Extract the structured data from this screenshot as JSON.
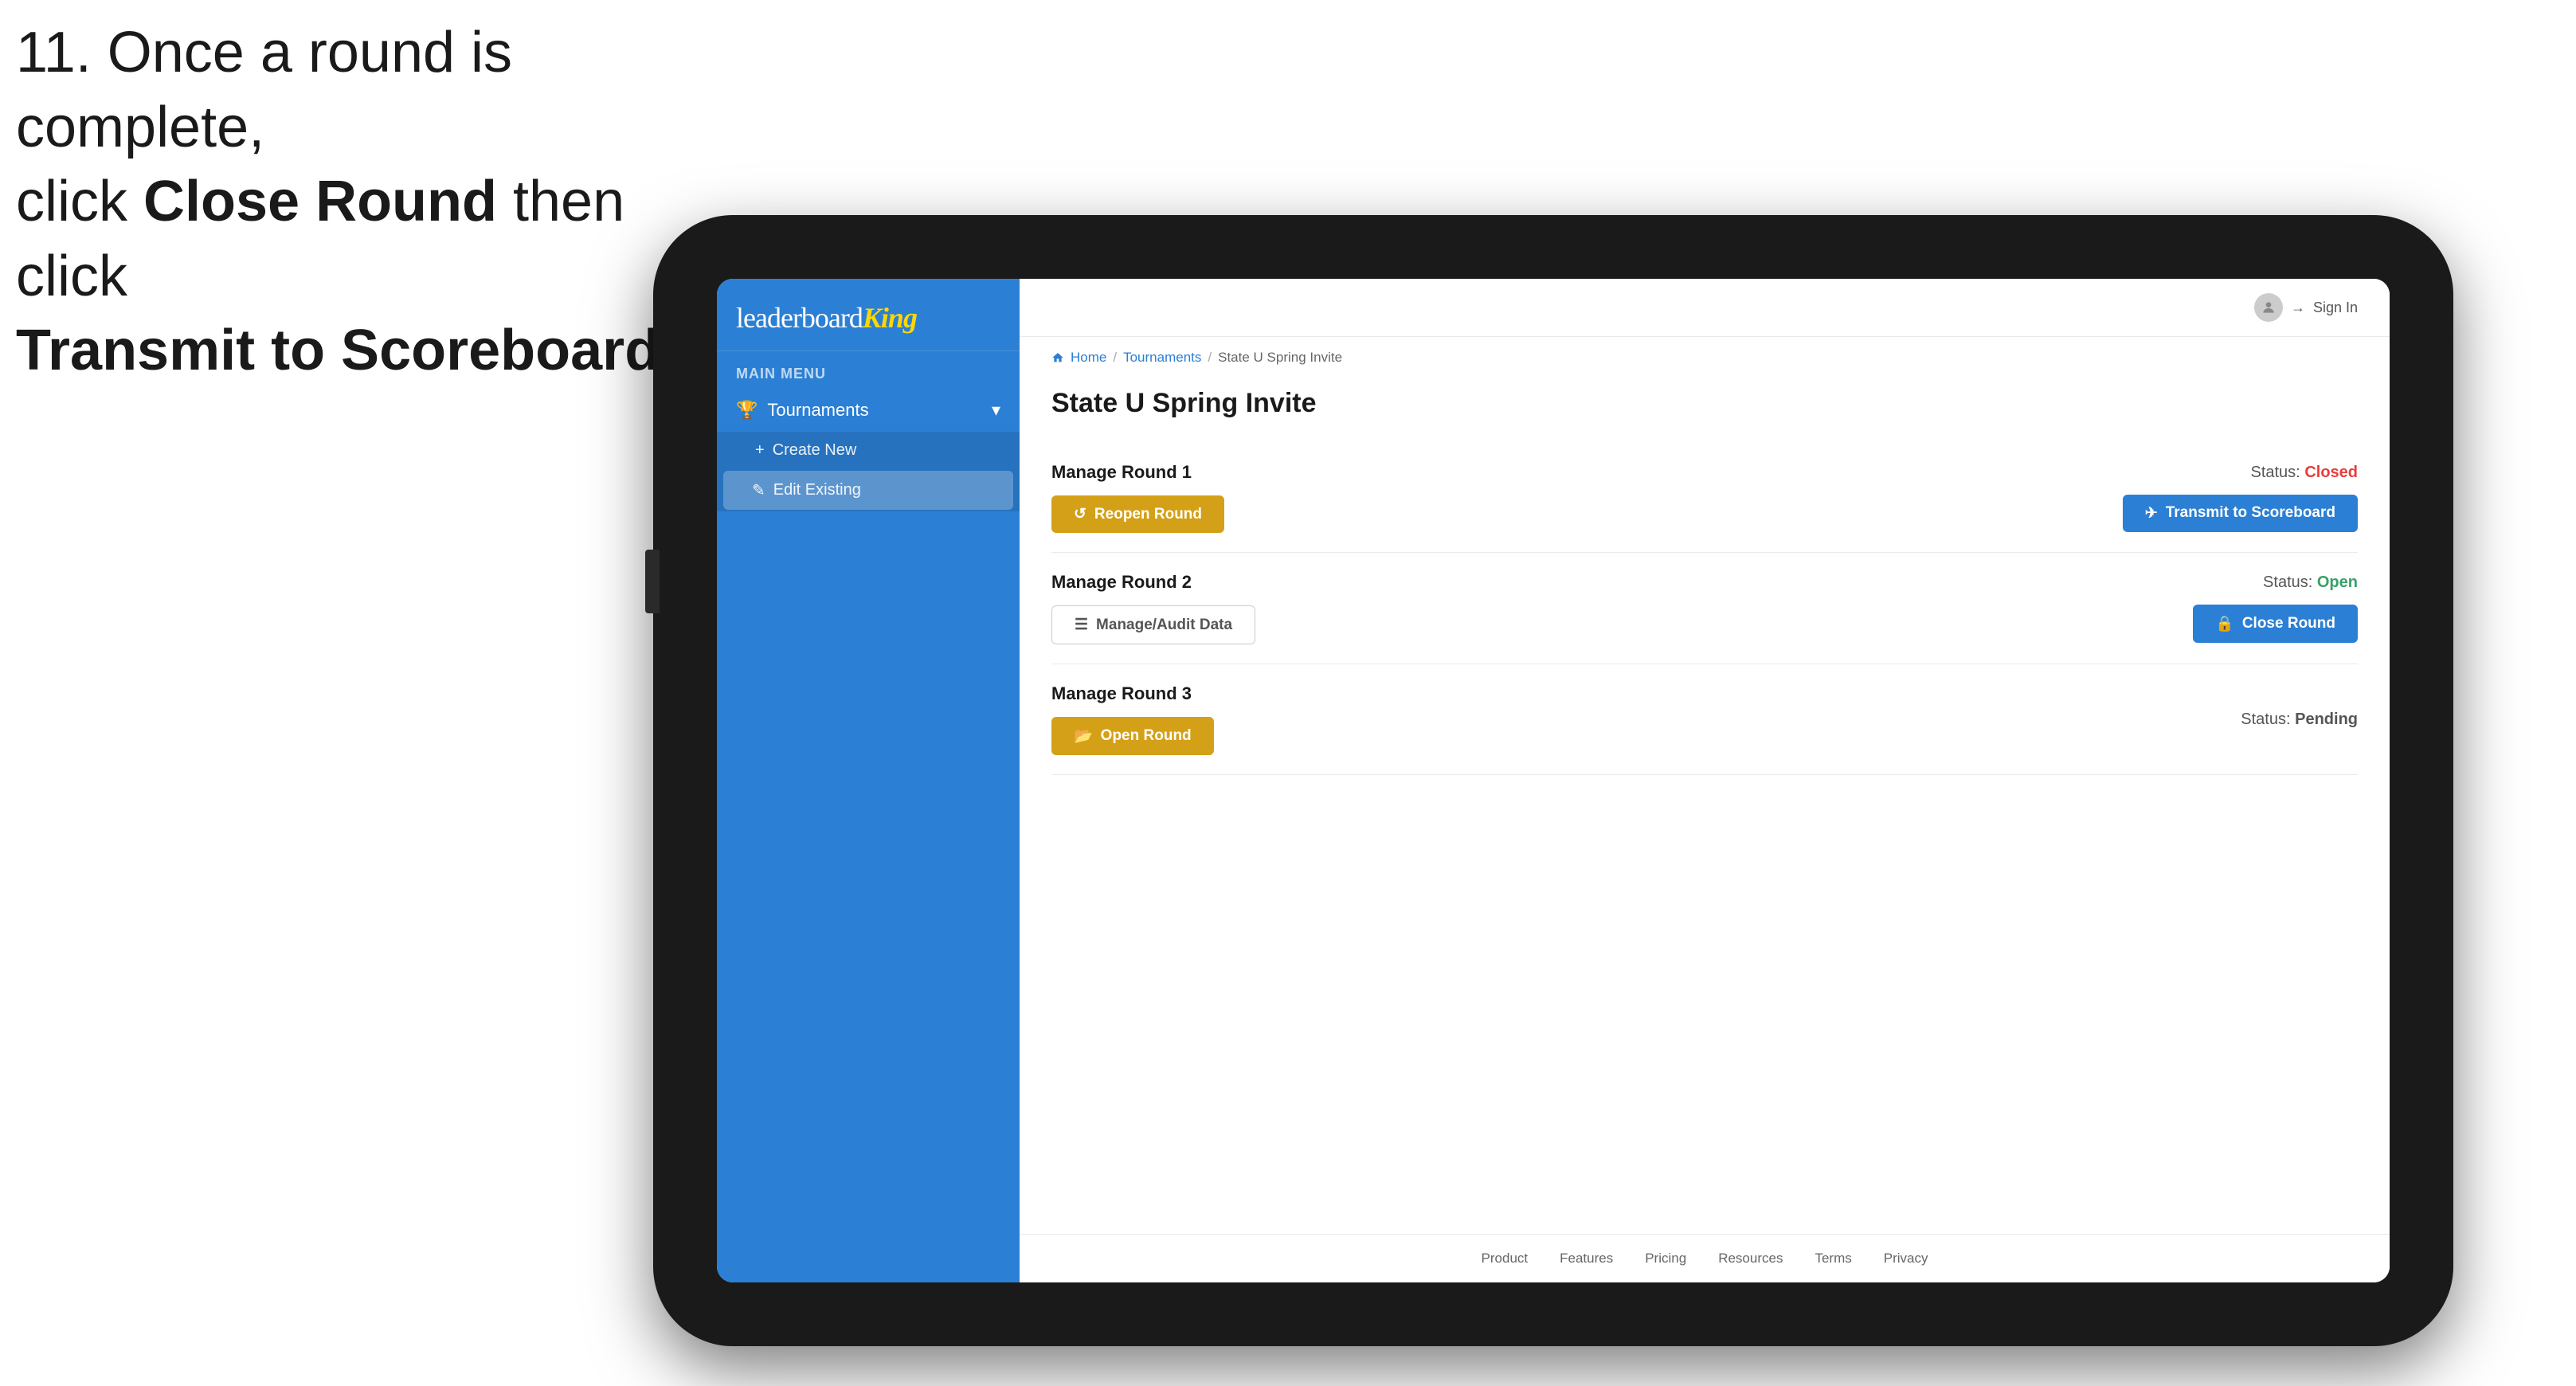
{
  "instruction": {
    "line1": "11. Once a round is complete,",
    "line2": "click ",
    "bold1": "Close Round",
    "line3": " then click",
    "bold2": "Transmit to Scoreboard."
  },
  "logo": {
    "leaderboard": "leaderboard",
    "king": "King"
  },
  "header": {
    "sign_in": "Sign In"
  },
  "breadcrumb": {
    "home": "Home",
    "tournaments": "Tournaments",
    "current": "State U Spring Invite"
  },
  "page": {
    "title": "State U Spring Invite"
  },
  "sidebar": {
    "main_menu_label": "MAIN MENU",
    "tournaments_label": "Tournaments",
    "create_new_label": "Create New",
    "edit_existing_label": "Edit Existing"
  },
  "rounds": [
    {
      "title": "Manage Round 1",
      "status_label": "Status:",
      "status_value": "Closed",
      "status_class": "status-closed",
      "button1_label": "Reopen Round",
      "button1_class": "btn-gold",
      "button2_label": "Transmit to Scoreboard",
      "button2_class": "btn-blue"
    },
    {
      "title": "Manage Round 2",
      "status_label": "Status:",
      "status_value": "Open",
      "status_class": "status-open",
      "button1_label": "Manage/Audit Data",
      "button1_class": "btn-outline",
      "button2_label": "Close Round",
      "button2_class": "btn-blue"
    },
    {
      "title": "Manage Round 3",
      "status_label": "Status:",
      "status_value": "Pending",
      "status_class": "status-pending",
      "button1_label": "Open Round",
      "button1_class": "btn-gold",
      "button2_label": null,
      "button2_class": null
    }
  ],
  "footer": {
    "links": [
      "Product",
      "Features",
      "Pricing",
      "Resources",
      "Terms",
      "Privacy"
    ]
  }
}
